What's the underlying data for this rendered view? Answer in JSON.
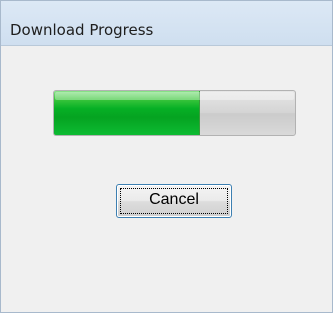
{
  "window": {
    "title": "Download Progress"
  },
  "progress": {
    "percent": 60,
    "color": "#06b025"
  },
  "buttons": {
    "cancel_label": "Cancel"
  }
}
